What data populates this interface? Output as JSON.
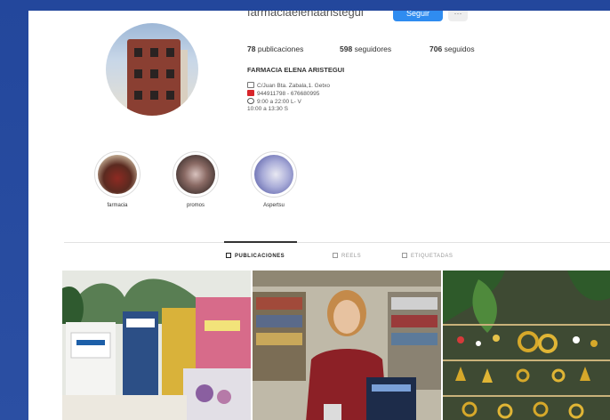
{
  "profile": {
    "username": "farmaciaelenaaristegui",
    "follow_label": "Seguir",
    "more_label": "···",
    "stats": {
      "posts": "78",
      "posts_label": "publicaciones",
      "followers": "598",
      "followers_label": "seguidores",
      "following": "706",
      "following_label": "seguidos"
    },
    "name": "FARMACIA ELENA ARISTEGUI",
    "bio": [
      {
        "icon": "house-icon",
        "text": "C/Juan Bta. Zabala,1. Getxo"
      },
      {
        "icon": "phone-icon",
        "text": "944911798 - 676680995"
      },
      {
        "icon": "clock-icon",
        "text": "9:00 a 22:00 L- V"
      },
      {
        "icon": "",
        "text": "10:00 a 13:30 S"
      }
    ]
  },
  "highlights": [
    {
      "label": "farmacia"
    },
    {
      "label": "promos"
    },
    {
      "label": "Aspertsu"
    }
  ],
  "tabs": [
    {
      "label": "PUBLICACIONES",
      "active": true
    },
    {
      "label": "REELS",
      "active": false
    },
    {
      "label": "ETIQUETADAS",
      "active": false
    }
  ],
  "colors": {
    "accent": "#2f8cf0",
    "background": "#2b4fa3"
  }
}
